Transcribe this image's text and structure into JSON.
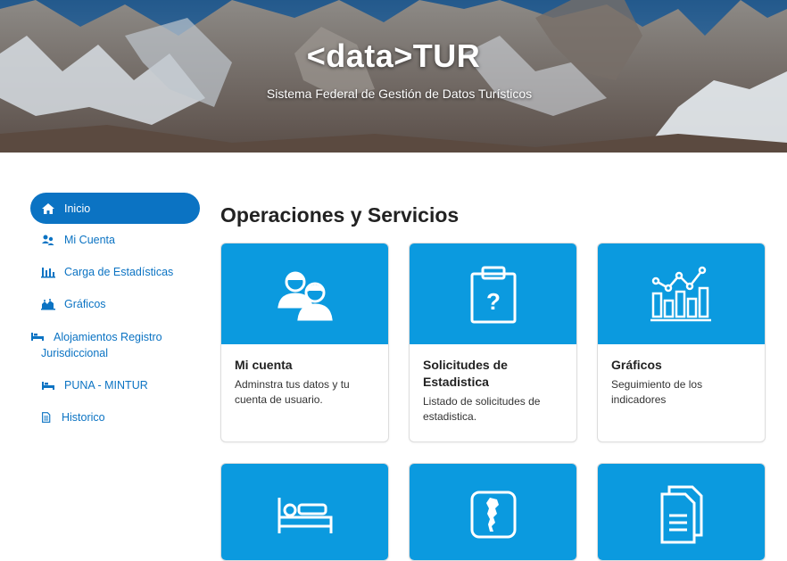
{
  "header": {
    "title": "<data>TUR",
    "subtitle": "Sistema Federal de Gestión de Datos Turísticos"
  },
  "sidebar": {
    "items": [
      {
        "label": "Inicio",
        "icon": "home-icon",
        "active": true
      },
      {
        "label": "Mi Cuenta",
        "icon": "users-icon"
      },
      {
        "label": "Carga de Estadísticas",
        "icon": "bar-chart-icon"
      },
      {
        "label": "Gráficos",
        "icon": "area-chart-icon"
      },
      {
        "label": "Alojamientos Registro Jurisdiccional",
        "icon": "bed-icon"
      },
      {
        "label": "PUNA - MINTUR",
        "icon": "bed-icon"
      },
      {
        "label": "Historico",
        "icon": "document-icon"
      }
    ]
  },
  "main": {
    "title": "Operaciones y Servicios",
    "cards": [
      {
        "title": "Mi cuenta",
        "description": "Adminstra tus datos y tu cuenta de usuario.",
        "icon": "users-icon"
      },
      {
        "title": "Solicitudes de Estadistica",
        "description": "Listado de solicitudes de estadistica.",
        "icon": "clipboard-question-icon"
      },
      {
        "title": "Gráficos",
        "description": "Seguimiento de los indicadores",
        "icon": "chart-icon"
      },
      {
        "title": "",
        "description": "",
        "icon": "bed-icon"
      },
      {
        "title": "",
        "description": "",
        "icon": "argentina-map-icon"
      },
      {
        "title": "",
        "description": "",
        "icon": "documents-icon"
      }
    ]
  },
  "colors": {
    "primary": "#0b73c3",
    "card_header": "#0b9adf"
  }
}
